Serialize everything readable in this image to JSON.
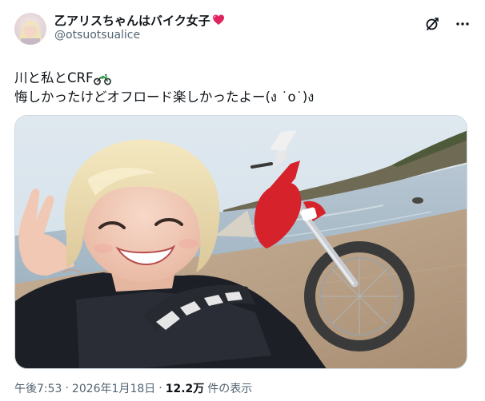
{
  "author": {
    "display_name": "乙アリスちゃんはバイク女子",
    "handle": "@otsuotsualice",
    "heart_icon": "red-heart-icon"
  },
  "actions": {
    "grok_icon": "grok-slash-icon",
    "more_icon": "more-dots-icon"
  },
  "post": {
    "line1": "川と私とCRF",
    "line1_emoji": "motorcycle-emoji",
    "line2": "悔しかったけどオフロード楽しかったよー(ง ˙o˙)ง"
  },
  "media": {
    "kind": "photo",
    "description_icon": "photo"
  },
  "meta": {
    "time": "午後7:53",
    "separator": "·",
    "date": "2026年1月18日",
    "views_count": "12.2万",
    "views_label": "件の表示"
  },
  "colors": {
    "text_primary": "#0f1419",
    "text_secondary": "#536471",
    "heart": "#f91880",
    "bike_red": "#d6232b"
  }
}
